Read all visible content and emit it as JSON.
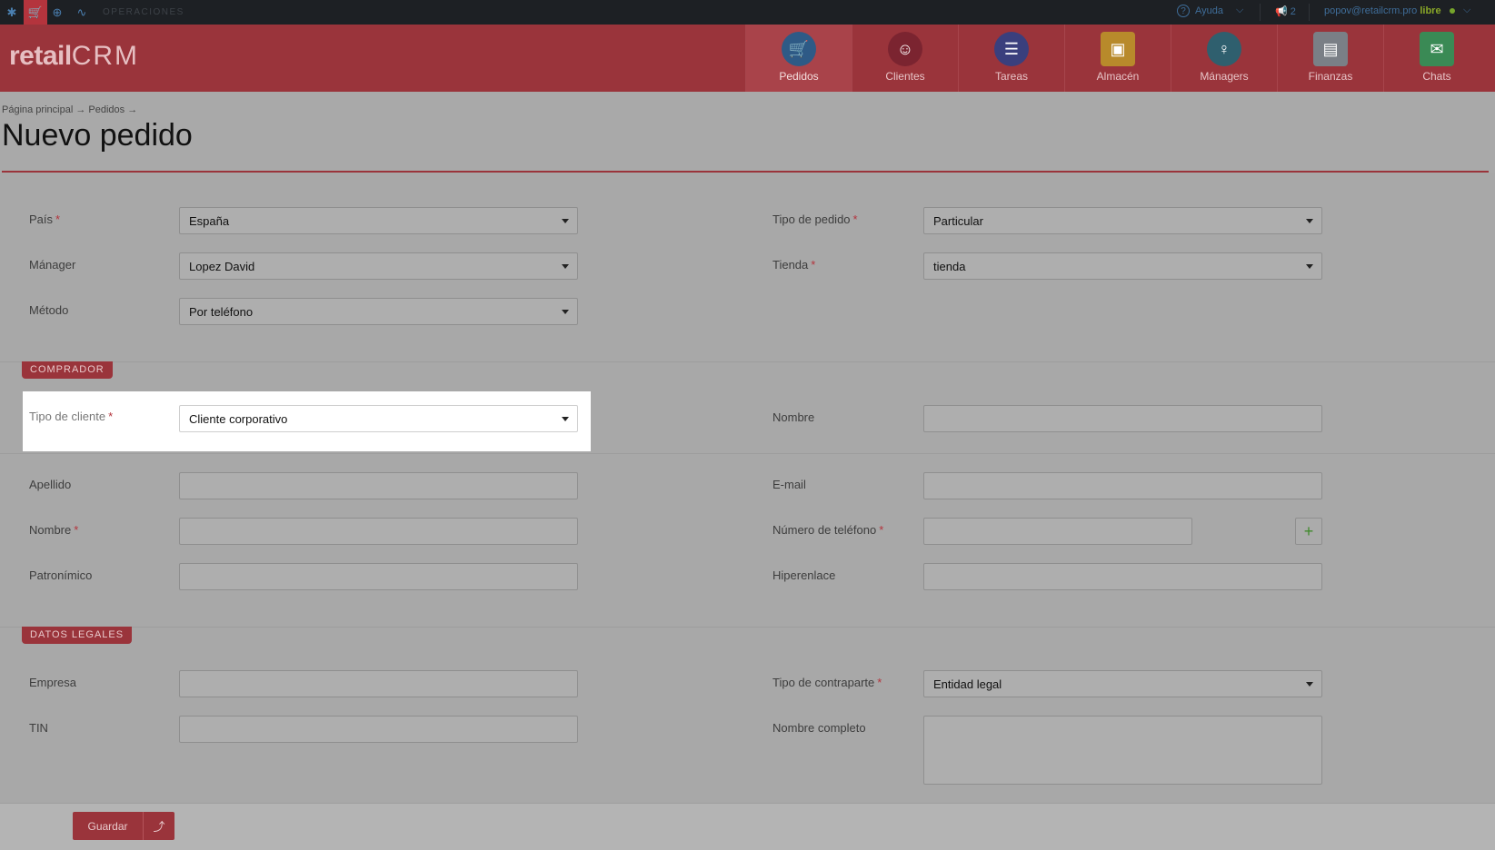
{
  "topbar": {
    "ops_label": "OPERACIONES",
    "help_label": "Ayuda",
    "notif_count": "2",
    "user_email": "popov@retailcrm.pro",
    "plan": "libre"
  },
  "logo": {
    "left": "retail",
    "right": "CRM"
  },
  "nav": [
    {
      "label": "Pedidos",
      "color": "#2e5a86",
      "icon": "cart-icon"
    },
    {
      "label": "Clientes",
      "color": "#7b2430",
      "icon": "person-icon"
    },
    {
      "label": "Tareas",
      "color": "#3a3f7d",
      "icon": "list-icon"
    },
    {
      "label": "Almacén",
      "color": "#b88a2b",
      "icon": "box-icon"
    },
    {
      "label": "Mánagers",
      "color": "#2f5f6e",
      "icon": "manager-icon"
    },
    {
      "label": "Finanzas",
      "color": "#7a7f86",
      "icon": "document-icon"
    },
    {
      "label": "Chats",
      "color": "#3a8a55",
      "icon": "chat-icon"
    }
  ],
  "breadcrumb": "Página principal → Pedidos →",
  "page_title": "Nuevo pedido",
  "main": {
    "pais_label": "País",
    "pais_value": "España",
    "manager_label": "Mánager",
    "manager_value": "Lopez David",
    "metodo_label": "Método",
    "metodo_value": "Por teléfono",
    "tipo_pedido_label": "Tipo de pedido",
    "tipo_pedido_value": "Particular",
    "tienda_label": "Tienda",
    "tienda_value": "tienda"
  },
  "comprador": {
    "section": "COMPRADOR",
    "tipo_cliente_label": "Tipo de cliente",
    "tipo_cliente_value": "Cliente corporativo",
    "nombre_right_label": "Nombre",
    "apellido_label": "Apellido",
    "email_label": "E-mail",
    "nombre_label": "Nombre",
    "telefono_label": "Número de teléfono",
    "patronimico_label": "Patronímico",
    "hiperenlace_label": "Hiperenlace"
  },
  "legal": {
    "section": "DATOS LEGALES",
    "empresa_label": "Empresa",
    "tipo_contraparte_label": "Tipo de contraparte",
    "tipo_contraparte_value": "Entidad legal",
    "tin_label": "TIN",
    "nombre_completo_label": "Nombre completo"
  },
  "footer": {
    "save_label": "Guardar"
  }
}
